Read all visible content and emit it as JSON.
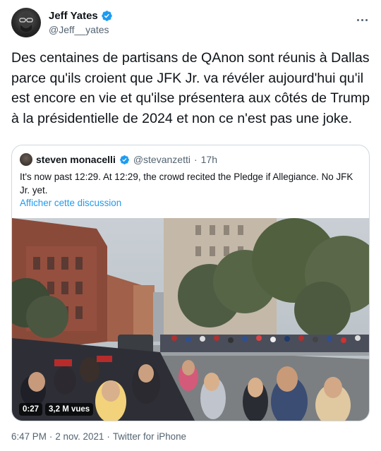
{
  "author": {
    "name": "Jeff Yates",
    "handle": "@Jeff__yates",
    "verified_icon": "verified-badge-icon"
  },
  "tweet": {
    "text": "Des centaines de partisans de QAnon sont réunis à Dallas parce qu'ils croient que JFK Jr. va révéler aujourd'hui qu'il est encore en vie et qu'ilse présentera aux côtés de Trump à la présidentielle de 2024 et non ce n'est pas une joke."
  },
  "quoted": {
    "name": "steven monacelli",
    "handle": "@stevanzetti",
    "separator": "·",
    "time": "17h",
    "text": "It's now past 12:29. At 12:29, the crowd recited the Pledge if Allegiance. No JFK Jr. yet.",
    "show_thread": "Afficher cette discussion",
    "video": {
      "duration": "0:27",
      "views": "3,2 M vues"
    }
  },
  "meta": {
    "time": "6:47 PM",
    "separator1": "·",
    "date": "2 nov. 2021",
    "separator2": "·",
    "source": "Twitter for iPhone"
  },
  "colors": {
    "link": "#1d9bf0",
    "secondary_text": "#536471",
    "border": "#cfd9de"
  }
}
